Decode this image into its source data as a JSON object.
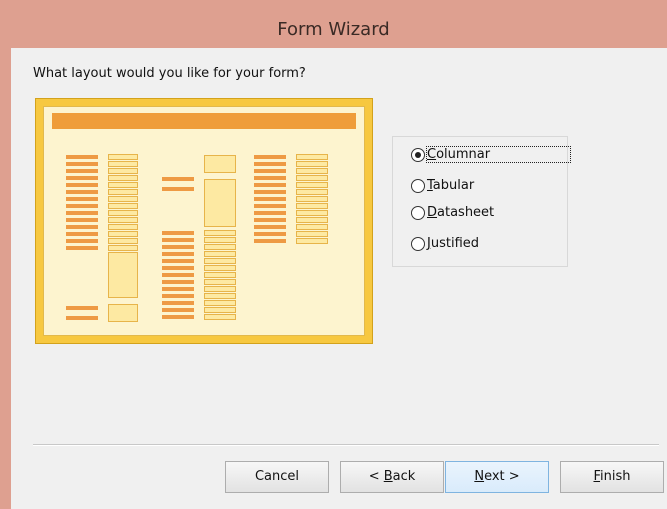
{
  "window": {
    "title": "Form Wizard"
  },
  "prompt": "What layout would you like for your form?",
  "layout_options": [
    {
      "label": "Columnar",
      "mnemonic": "C",
      "rest": "olumnar",
      "selected": true
    },
    {
      "label": "Tabular",
      "mnemonic": "T",
      "rest": "abular",
      "selected": false
    },
    {
      "label": "Datasheet",
      "mnemonic": "D",
      "rest": "atasheet",
      "selected": false
    },
    {
      "label": "Justified",
      "mnemonic": "J",
      "rest": "ustified",
      "selected": false
    }
  ],
  "buttons": {
    "cancel": "Cancel",
    "back_prefix": "< ",
    "back_mnemonic": "B",
    "back_rest": "ack",
    "next_mnemonic": "N",
    "next_rest": "ext >",
    "finish_mnemonic": "F",
    "finish_rest": "inish"
  },
  "colors": {
    "titlebar": "#dea090",
    "preview_frame": "#f7c840",
    "preview_label": "#ee9a44",
    "preview_field": "#fde9a2"
  }
}
